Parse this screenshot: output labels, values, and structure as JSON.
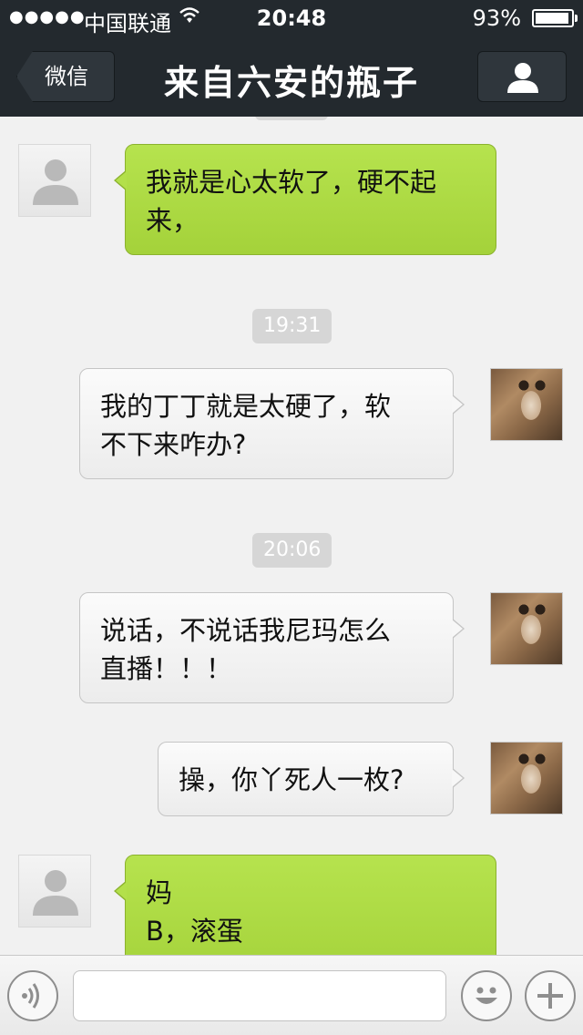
{
  "status_bar": {
    "signal": "●●●●●",
    "carrier": "中国联通",
    "wifi_icon": "wifi-icon",
    "time": "20:48",
    "battery_percent": "93%",
    "battery_level": 0.93
  },
  "navbar": {
    "back_label": "微信",
    "title": "来自六安的瓶子",
    "profile_icon": "person-icon"
  },
  "messages": [
    {
      "side": "left",
      "lines": [
        "我就是心太软了，硬不起",
        "来，"
      ]
    },
    {
      "timestamp": "19:31"
    },
    {
      "side": "right",
      "lines": [
        "我的丁丁就是太硬了，软",
        "不下来咋办?"
      ]
    },
    {
      "timestamp": "20:06"
    },
    {
      "side": "right",
      "lines": [
        "说话，不说话我尼玛怎么",
        "直播！！！"
      ]
    },
    {
      "side": "right",
      "lines": [
        "操，你丫死人一枚?"
      ]
    },
    {
      "side": "left",
      "lines": [
        "妈",
        "B，滚蛋"
      ]
    }
  ],
  "input_bar": {
    "voice_icon": "voice-icon",
    "text_value": "",
    "emoji_icon": "emoji-icon",
    "plus_icon": "plus-icon"
  },
  "colors": {
    "nav_bg": "#23292e",
    "green_bubble": "#a8d640",
    "white_bubble": "#f3f3f3",
    "chat_bg": "#f1f1f1"
  }
}
